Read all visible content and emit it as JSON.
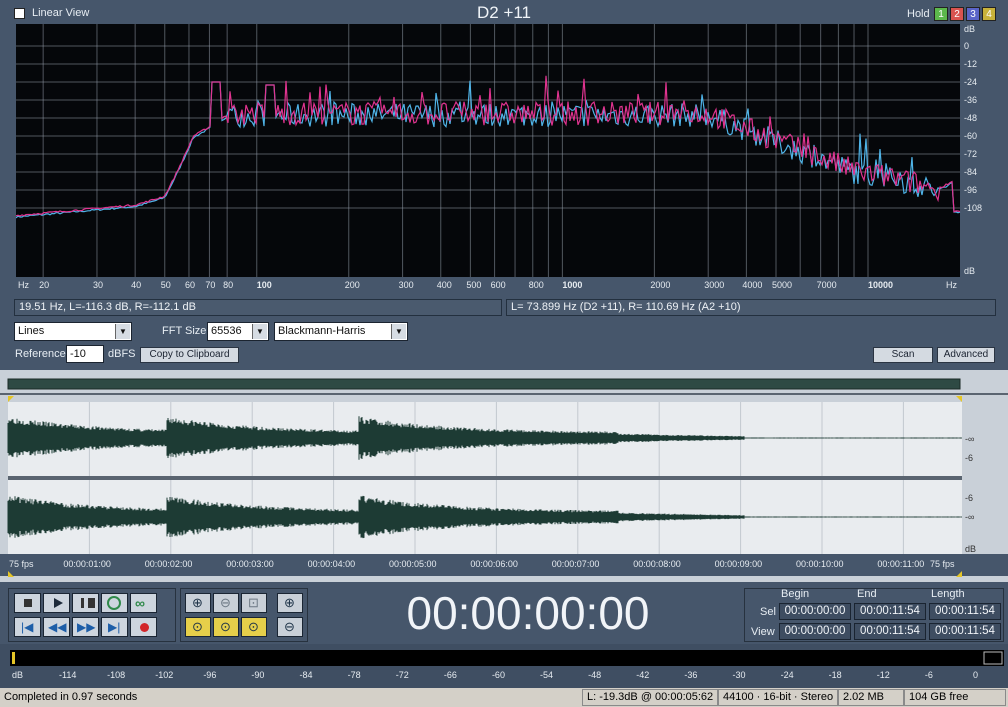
{
  "header": {
    "linear_view_label": "Linear View",
    "title": "D2 +11",
    "hold_label": "Hold",
    "hold_buttons": [
      {
        "label": "1",
        "color": "#5cb84c"
      },
      {
        "label": "2",
        "color": "#d9534f"
      },
      {
        "label": "3",
        "color": "#5a64c8"
      },
      {
        "label": "4",
        "color": "#c8b23a"
      }
    ]
  },
  "spectrum": {
    "x_unit_left": "Hz",
    "x_unit_right": "Hz",
    "freq_ticks": [
      "20",
      "30",
      "40",
      "50",
      "60",
      "70",
      "80",
      "100",
      "200",
      "300",
      "400",
      "500",
      "600",
      "800",
      "1000",
      "2000",
      "3000",
      "4000",
      "5000",
      "7000",
      "10000"
    ],
    "db_ticks": [
      "dB",
      "0",
      "-12",
      "-24",
      "-36",
      "-48",
      "-60",
      "-72",
      "-84",
      "-96",
      "-108",
      "dB"
    ],
    "series_colors": {
      "left": "#4fb4e8",
      "right": "#e0338f"
    }
  },
  "readouts": {
    "cursor": "19.51 Hz, L=-116.3 dB, R=-112.1 dB",
    "peak": "L= 73.899 Hz (D2 +11), R= 110.69 Hz (A2 +10)"
  },
  "controls": {
    "display_mode": "Lines",
    "fft_size_label": "FFT Size",
    "fft_size": "65536",
    "window_function": "Blackmann-Harris",
    "reference_label": "Reference",
    "reference_value": "-10",
    "reference_unit": "dBFS",
    "copy_button": "Copy to Clipboard",
    "scan_button": "Scan",
    "advanced_button": "Advanced"
  },
  "waveform": {
    "time_ticks": [
      "75 fps",
      "00:00:01:00",
      "00:00:02:00",
      "00:00:03:00",
      "00:00:04:00",
      "00:00:05:00",
      "00:00:06:00",
      "00:00:07:00",
      "00:00:08:00",
      "00:00:09:00",
      "00:00:10:00",
      "00:00:11:00",
      "75 fps"
    ],
    "ch1_scale": [
      "-∞",
      "-6"
    ],
    "ch2_scale": [
      "-6",
      "-∞",
      "dB"
    ],
    "wave_color": "#1d3b34"
  },
  "transport": {
    "clock": "00:00:00:00",
    "begin_label": "Begin",
    "end_label": "End",
    "length_label": "Length",
    "sel_label": "Sel",
    "view_label": "View",
    "sel_begin": "00:00:00:00",
    "sel_end": "00:00:11:54",
    "sel_length": "00:00:11:54",
    "view_begin": "00:00:00:00",
    "view_end": "00:00:11:54",
    "view_length": "00:00:11:54"
  },
  "meter": {
    "scale": [
      "dB",
      "-114",
      "-108",
      "-102",
      "-96",
      "-90",
      "-84",
      "-78",
      "-72",
      "-66",
      "-60",
      "-54",
      "-48",
      "-42",
      "-36",
      "-30",
      "-24",
      "-18",
      "-12",
      "-6",
      "0"
    ]
  },
  "status": {
    "message": "Completed in 0.97 seconds",
    "level": "L: -19.3dB @ 00:00:05:62",
    "format": "44100 · 16-bit · Stereo",
    "size": "2.02 MB",
    "free": "104 GB free"
  }
}
